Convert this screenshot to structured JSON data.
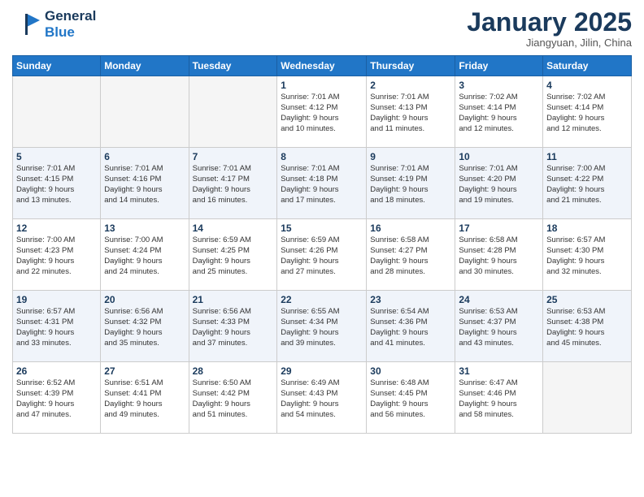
{
  "header": {
    "logo_line1": "General",
    "logo_line2": "Blue",
    "month": "January 2025",
    "location": "Jiangyuan, Jilin, China"
  },
  "weekdays": [
    "Sunday",
    "Monday",
    "Tuesday",
    "Wednesday",
    "Thursday",
    "Friday",
    "Saturday"
  ],
  "weeks": [
    [
      {
        "day": "",
        "info": ""
      },
      {
        "day": "",
        "info": ""
      },
      {
        "day": "",
        "info": ""
      },
      {
        "day": "1",
        "info": "Sunrise: 7:01 AM\nSunset: 4:12 PM\nDaylight: 9 hours\nand 10 minutes."
      },
      {
        "day": "2",
        "info": "Sunrise: 7:01 AM\nSunset: 4:13 PM\nDaylight: 9 hours\nand 11 minutes."
      },
      {
        "day": "3",
        "info": "Sunrise: 7:02 AM\nSunset: 4:14 PM\nDaylight: 9 hours\nand 12 minutes."
      },
      {
        "day": "4",
        "info": "Sunrise: 7:02 AM\nSunset: 4:14 PM\nDaylight: 9 hours\nand 12 minutes."
      }
    ],
    [
      {
        "day": "5",
        "info": "Sunrise: 7:01 AM\nSunset: 4:15 PM\nDaylight: 9 hours\nand 13 minutes."
      },
      {
        "day": "6",
        "info": "Sunrise: 7:01 AM\nSunset: 4:16 PM\nDaylight: 9 hours\nand 14 minutes."
      },
      {
        "day": "7",
        "info": "Sunrise: 7:01 AM\nSunset: 4:17 PM\nDaylight: 9 hours\nand 16 minutes."
      },
      {
        "day": "8",
        "info": "Sunrise: 7:01 AM\nSunset: 4:18 PM\nDaylight: 9 hours\nand 17 minutes."
      },
      {
        "day": "9",
        "info": "Sunrise: 7:01 AM\nSunset: 4:19 PM\nDaylight: 9 hours\nand 18 minutes."
      },
      {
        "day": "10",
        "info": "Sunrise: 7:01 AM\nSunset: 4:20 PM\nDaylight: 9 hours\nand 19 minutes."
      },
      {
        "day": "11",
        "info": "Sunrise: 7:00 AM\nSunset: 4:22 PM\nDaylight: 9 hours\nand 21 minutes."
      }
    ],
    [
      {
        "day": "12",
        "info": "Sunrise: 7:00 AM\nSunset: 4:23 PM\nDaylight: 9 hours\nand 22 minutes."
      },
      {
        "day": "13",
        "info": "Sunrise: 7:00 AM\nSunset: 4:24 PM\nDaylight: 9 hours\nand 24 minutes."
      },
      {
        "day": "14",
        "info": "Sunrise: 6:59 AM\nSunset: 4:25 PM\nDaylight: 9 hours\nand 25 minutes."
      },
      {
        "day": "15",
        "info": "Sunrise: 6:59 AM\nSunset: 4:26 PM\nDaylight: 9 hours\nand 27 minutes."
      },
      {
        "day": "16",
        "info": "Sunrise: 6:58 AM\nSunset: 4:27 PM\nDaylight: 9 hours\nand 28 minutes."
      },
      {
        "day": "17",
        "info": "Sunrise: 6:58 AM\nSunset: 4:28 PM\nDaylight: 9 hours\nand 30 minutes."
      },
      {
        "day": "18",
        "info": "Sunrise: 6:57 AM\nSunset: 4:30 PM\nDaylight: 9 hours\nand 32 minutes."
      }
    ],
    [
      {
        "day": "19",
        "info": "Sunrise: 6:57 AM\nSunset: 4:31 PM\nDaylight: 9 hours\nand 33 minutes."
      },
      {
        "day": "20",
        "info": "Sunrise: 6:56 AM\nSunset: 4:32 PM\nDaylight: 9 hours\nand 35 minutes."
      },
      {
        "day": "21",
        "info": "Sunrise: 6:56 AM\nSunset: 4:33 PM\nDaylight: 9 hours\nand 37 minutes."
      },
      {
        "day": "22",
        "info": "Sunrise: 6:55 AM\nSunset: 4:34 PM\nDaylight: 9 hours\nand 39 minutes."
      },
      {
        "day": "23",
        "info": "Sunrise: 6:54 AM\nSunset: 4:36 PM\nDaylight: 9 hours\nand 41 minutes."
      },
      {
        "day": "24",
        "info": "Sunrise: 6:53 AM\nSunset: 4:37 PM\nDaylight: 9 hours\nand 43 minutes."
      },
      {
        "day": "25",
        "info": "Sunrise: 6:53 AM\nSunset: 4:38 PM\nDaylight: 9 hours\nand 45 minutes."
      }
    ],
    [
      {
        "day": "26",
        "info": "Sunrise: 6:52 AM\nSunset: 4:39 PM\nDaylight: 9 hours\nand 47 minutes."
      },
      {
        "day": "27",
        "info": "Sunrise: 6:51 AM\nSunset: 4:41 PM\nDaylight: 9 hours\nand 49 minutes."
      },
      {
        "day": "28",
        "info": "Sunrise: 6:50 AM\nSunset: 4:42 PM\nDaylight: 9 hours\nand 51 minutes."
      },
      {
        "day": "29",
        "info": "Sunrise: 6:49 AM\nSunset: 4:43 PM\nDaylight: 9 hours\nand 54 minutes."
      },
      {
        "day": "30",
        "info": "Sunrise: 6:48 AM\nSunset: 4:45 PM\nDaylight: 9 hours\nand 56 minutes."
      },
      {
        "day": "31",
        "info": "Sunrise: 6:47 AM\nSunset: 4:46 PM\nDaylight: 9 hours\nand 58 minutes."
      },
      {
        "day": "",
        "info": ""
      }
    ]
  ]
}
